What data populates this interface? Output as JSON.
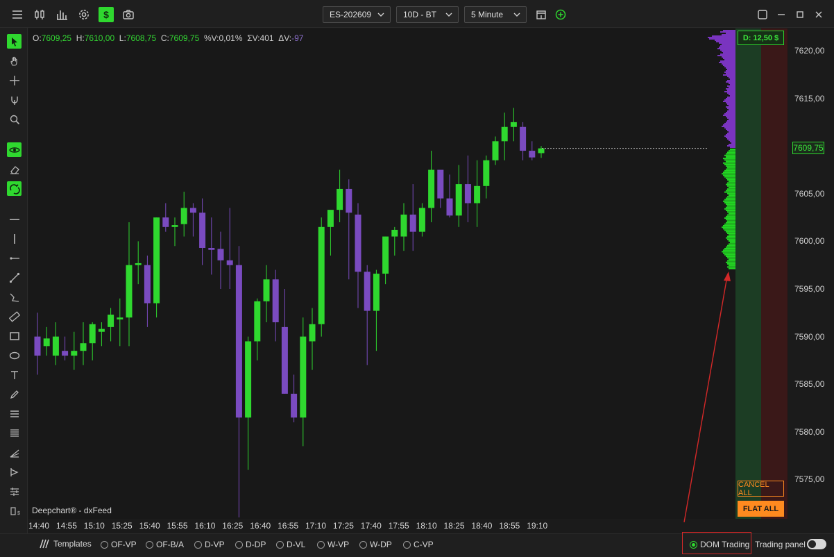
{
  "header": {
    "symbol": "ES-202609",
    "period": "10D - BT",
    "timeframe": "5 Minute"
  },
  "ohlc": {
    "o_label": "O:",
    "o": "7609,25",
    "h_label": "H:",
    "h": "7610,00",
    "l_label": "L:",
    "l": "7608,75",
    "c_label": "C:",
    "c": "7609,75",
    "pv_label": "%V:",
    "pv": "0,01%",
    "sv_label": "ΣV:",
    "sv": "401",
    "dv_label": "ΔV:",
    "dv": "-97"
  },
  "watermark": "Deepchart® - dxFeed",
  "dom": {
    "delta_label": "D: 12,50 $",
    "cancel_all": "CANCEL ALL",
    "flat_all": "FLAT ALL"
  },
  "bottom": {
    "templates": "Templates",
    "indicators": [
      "OF-VP",
      "OF-B/A",
      "D-VP",
      "D-DP",
      "D-VL",
      "W-VP",
      "W-DP",
      "C-VP"
    ],
    "dom_trading": "DOM Trading",
    "trading_panel": "Trading panel"
  },
  "colors": {
    "up": "#2fd82f",
    "down": "#7a4bc0",
    "bid": "#1c3d24",
    "ask": "#3a1818",
    "accent": "#ff8a1f",
    "highlight": "#d42828"
  },
  "chart_data": {
    "type": "candlestick",
    "x_ticks": [
      "14:40",
      "14:55",
      "15:10",
      "15:25",
      "15:40",
      "15:55",
      "16:10",
      "16:25",
      "16:40",
      "16:55",
      "17:10",
      "17:25",
      "17:40",
      "17:55",
      "18:10",
      "18:25",
      "18:40",
      "18:55",
      "19:10"
    ],
    "y_ticks": [
      "7620,00",
      "7615,00",
      "7610,00",
      "7605,00",
      "7600,00",
      "7595,00",
      "7590,00",
      "7585,00",
      "7580,00",
      "7575,00"
    ],
    "ylim": [
      7572.0,
      7622.8
    ],
    "current_price": "7609,75",
    "candles": [
      {
        "o": 7590.0,
        "h": 7592.5,
        "l": 7586.0,
        "c": 7588.0
      },
      {
        "o": 7589.0,
        "h": 7591.0,
        "l": 7588.0,
        "c": 7589.8
      },
      {
        "o": 7588.0,
        "h": 7591.5,
        "l": 7587.0,
        "c": 7590.0
      },
      {
        "o": 7588.5,
        "h": 7590.0,
        "l": 7587.5,
        "c": 7588.0
      },
      {
        "o": 7588.0,
        "h": 7590.5,
        "l": 7586.5,
        "c": 7588.5
      },
      {
        "o": 7588.5,
        "h": 7591.5,
        "l": 7587.0,
        "c": 7589.3
      },
      {
        "o": 7589.3,
        "h": 7591.5,
        "l": 7587.5,
        "c": 7591.3
      },
      {
        "o": 7590.5,
        "h": 7591.5,
        "l": 7589.0,
        "c": 7590.8
      },
      {
        "o": 7591.0,
        "h": 7593.0,
        "l": 7589.5,
        "c": 7592.3
      },
      {
        "o": 7591.8,
        "h": 7594.0,
        "l": 7589.0,
        "c": 7592.0
      },
      {
        "o": 7592.0,
        "h": 7602.0,
        "l": 7589.0,
        "c": 7597.5
      },
      {
        "o": 7597.5,
        "h": 7600.0,
        "l": 7595.5,
        "c": 7597.7
      },
      {
        "o": 7597.5,
        "h": 7598.5,
        "l": 7591.0,
        "c": 7593.5
      },
      {
        "o": 7593.5,
        "h": 7602.5,
        "l": 7592.0,
        "c": 7602.5
      },
      {
        "o": 7602.5,
        "h": 7604.0,
        "l": 7601.0,
        "c": 7601.5
      },
      {
        "o": 7601.5,
        "h": 7602.5,
        "l": 7599.5,
        "c": 7601.7
      },
      {
        "o": 7601.8,
        "h": 7605.2,
        "l": 7600.5,
        "c": 7603.5
      },
      {
        "o": 7603.5,
        "h": 7604.0,
        "l": 7600.5,
        "c": 7603.0
      },
      {
        "o": 7603.0,
        "h": 7604.5,
        "l": 7597.5,
        "c": 7599.3
      },
      {
        "o": 7599.3,
        "h": 7602.5,
        "l": 7596.5,
        "c": 7599.1
      },
      {
        "o": 7599.2,
        "h": 7601.0,
        "l": 7595.0,
        "c": 7598.0
      },
      {
        "o": 7598.0,
        "h": 7603.5,
        "l": 7595.0,
        "c": 7597.5
      },
      {
        "o": 7597.5,
        "h": 7599.5,
        "l": 7570.0,
        "c": 7581.5
      },
      {
        "o": 7581.5,
        "h": 7590.0,
        "l": 7576.0,
        "c": 7589.5
      },
      {
        "o": 7589.5,
        "h": 7594.0,
        "l": 7587.5,
        "c": 7593.7
      },
      {
        "o": 7593.7,
        "h": 7597.5,
        "l": 7591.5,
        "c": 7596.0
      },
      {
        "o": 7596.0,
        "h": 7597.0,
        "l": 7589.5,
        "c": 7591.5
      },
      {
        "o": 7591.0,
        "h": 7595.0,
        "l": 7584.0,
        "c": 7584.0
      },
      {
        "o": 7584.0,
        "h": 7586.0,
        "l": 7581.0,
        "c": 7581.5
      },
      {
        "o": 7581.5,
        "h": 7592.0,
        "l": 7578.5,
        "c": 7590.0
      },
      {
        "o": 7589.5,
        "h": 7593.0,
        "l": 7586.5,
        "c": 7591.3
      },
      {
        "o": 7591.3,
        "h": 7602.5,
        "l": 7590.0,
        "c": 7601.5
      },
      {
        "o": 7601.5,
        "h": 7603.0,
        "l": 7598.5,
        "c": 7603.3
      },
      {
        "o": 7603.3,
        "h": 7607.5,
        "l": 7602.0,
        "c": 7605.5
      },
      {
        "o": 7605.5,
        "h": 7606.5,
        "l": 7596.0,
        "c": 7603.0
      },
      {
        "o": 7602.8,
        "h": 7604.0,
        "l": 7593.0,
        "c": 7596.8
      },
      {
        "o": 7596.8,
        "h": 7597.5,
        "l": 7587.0,
        "c": 7592.7
      },
      {
        "o": 7592.7,
        "h": 7597.0,
        "l": 7588.5,
        "c": 7596.6
      },
      {
        "o": 7596.6,
        "h": 7600.5,
        "l": 7595.5,
        "c": 7600.5
      },
      {
        "o": 7600.5,
        "h": 7601.5,
        "l": 7598.5,
        "c": 7601.2
      },
      {
        "o": 7600.5,
        "h": 7604.0,
        "l": 7599.0,
        "c": 7602.8
      },
      {
        "o": 7602.8,
        "h": 7606.0,
        "l": 7599.0,
        "c": 7601.0
      },
      {
        "o": 7601.0,
        "h": 7604.0,
        "l": 7600.5,
        "c": 7603.5
      },
      {
        "o": 7603.5,
        "h": 7609.5,
        "l": 7602.0,
        "c": 7607.5
      },
      {
        "o": 7607.5,
        "h": 7607.5,
        "l": 7603.5,
        "c": 7604.5
      },
      {
        "o": 7604.5,
        "h": 7607.0,
        "l": 7602.5,
        "c": 7602.7
      },
      {
        "o": 7602.7,
        "h": 7608.0,
        "l": 7601.5,
        "c": 7606.0
      },
      {
        "o": 7606.0,
        "h": 7609.0,
        "l": 7602.0,
        "c": 7604.0
      },
      {
        "o": 7604.0,
        "h": 7608.5,
        "l": 7601.5,
        "c": 7605.8
      },
      {
        "o": 7605.8,
        "h": 7609.0,
        "l": 7604.5,
        "c": 7608.5
      },
      {
        "o": 7608.5,
        "h": 7611.0,
        "l": 7608.0,
        "c": 7610.5
      },
      {
        "o": 7610.5,
        "h": 7613.5,
        "l": 7608.5,
        "c": 7612.0
      },
      {
        "o": 7612.0,
        "h": 7614.0,
        "l": 7610.5,
        "c": 7612.5
      },
      {
        "o": 7612.0,
        "h": 7612.5,
        "l": 7608.5,
        "c": 7609.5
      },
      {
        "o": 7609.5,
        "h": 7610.5,
        "l": 7608.5,
        "c": 7608.8
      },
      {
        "o": 7609.25,
        "h": 7610.0,
        "l": 7608.75,
        "c": 7609.75
      }
    ]
  }
}
